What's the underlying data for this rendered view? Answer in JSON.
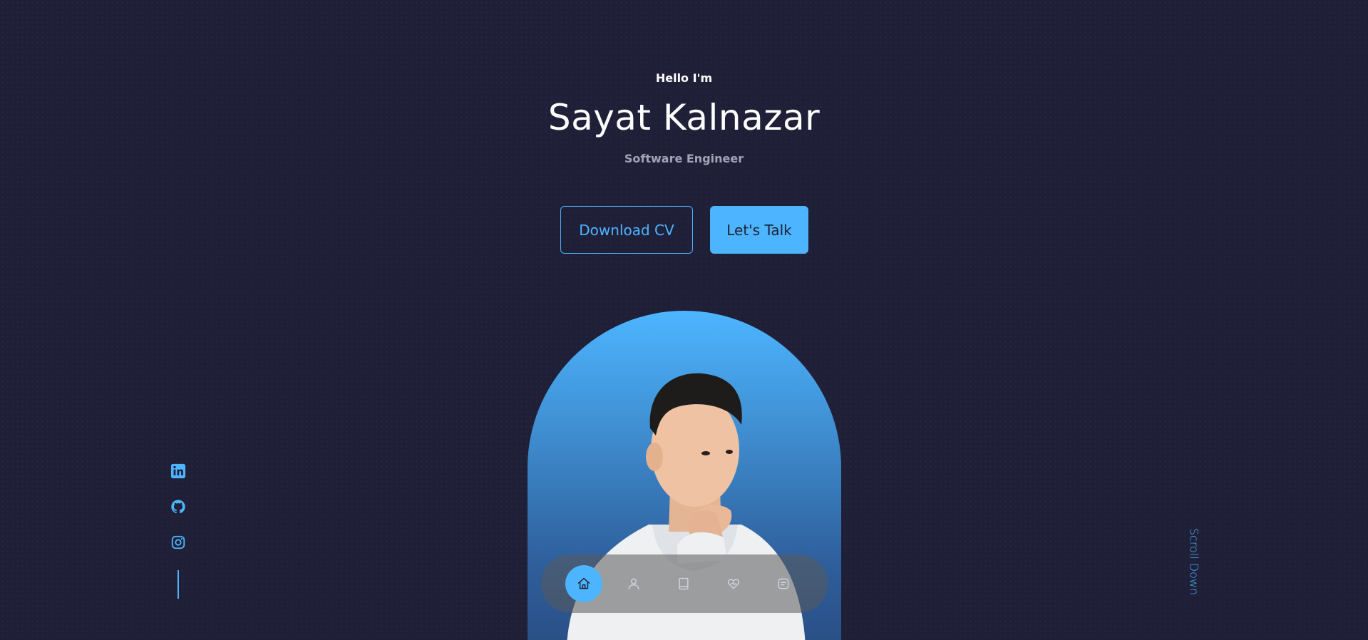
{
  "header": {
    "greeting": "Hello I'm",
    "name": "Sayat Kalnazar",
    "role": "Software Engineer"
  },
  "actions": {
    "download_cv": "Download CV",
    "lets_talk": "Let's Talk"
  },
  "socials": [
    {
      "icon": "linkedin-icon"
    },
    {
      "icon": "github-icon"
    },
    {
      "icon": "instagram-icon"
    }
  ],
  "scroll_hint": "Scroll Down",
  "nav": {
    "items": [
      {
        "icon": "home-icon",
        "active": true
      },
      {
        "icon": "user-icon",
        "active": false
      },
      {
        "icon": "book-icon",
        "active": false
      },
      {
        "icon": "services-icon",
        "active": false
      },
      {
        "icon": "message-icon",
        "active": false
      }
    ]
  },
  "colors": {
    "background": "#1f1f38",
    "accent": "#4db5ff",
    "muted_text": "#a3a3b8",
    "text": "#ffffff"
  }
}
